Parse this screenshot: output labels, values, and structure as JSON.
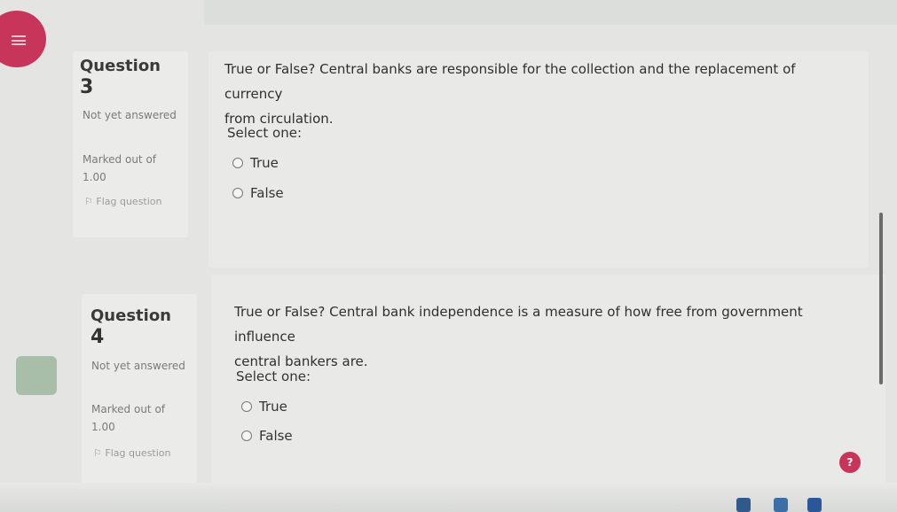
{
  "questions": [
    {
      "label": "Question",
      "number": "3",
      "status": "Not yet answered",
      "marked": "Marked out of 1.00",
      "flag": "Flag question",
      "text_line1": "True or False? Central banks are responsible for the collection and the replacement of currency",
      "text_line2": "from circulation.",
      "select_prompt": "Select one:",
      "options": [
        "True",
        "False"
      ]
    },
    {
      "label": "Question",
      "number": "4",
      "status": "Not yet answered",
      "marked": "Marked out of 1.00",
      "flag": "Flag question",
      "text_line1": "True or False? Central bank independence is a measure of how free from government influence",
      "text_line2": "central bankers are.",
      "select_prompt": "Select one:",
      "options": [
        "True",
        "False"
      ]
    }
  ],
  "help_button": "?",
  "icons": {
    "menu": "hamburger-menu-icon",
    "flag": "flag-icon",
    "help": "help-icon"
  }
}
